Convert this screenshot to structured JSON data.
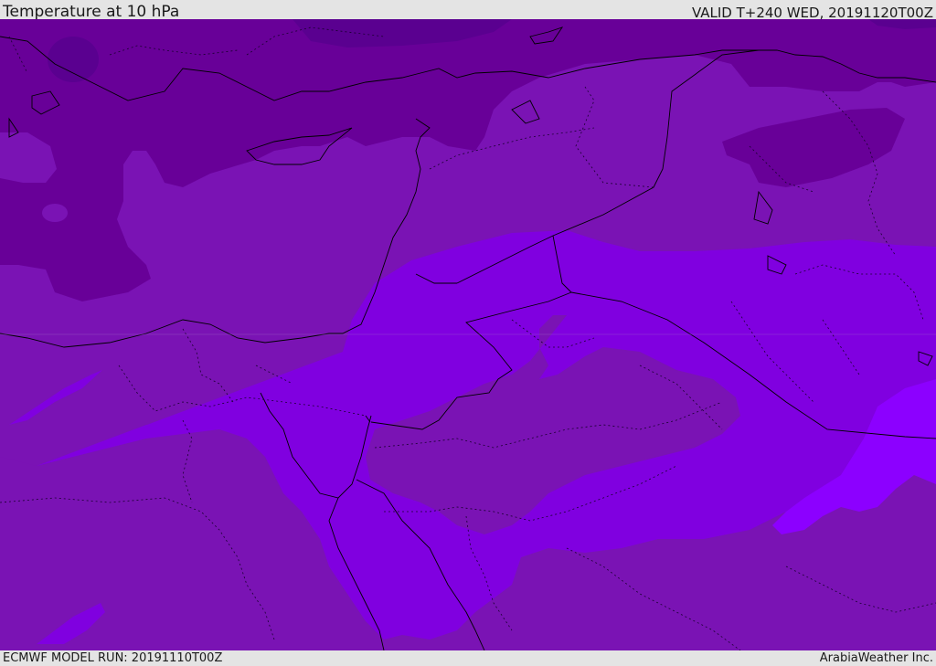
{
  "header": {
    "title": "Temperature at 10 hPa",
    "valid_time": "VALID T+240 WED, 20191120T00Z"
  },
  "footer": {
    "model_run": "ECMWF MODEL RUN: 20191110T00Z",
    "credit": "ArabiaWeather Inc."
  },
  "map": {
    "field": "temperature",
    "level": "10 hPa",
    "colors": {
      "darkest": "#5a0090",
      "dark": "#680098",
      "medium": "#7a13b4",
      "light": "#8000e0",
      "lightest": "#8c00ff",
      "coastline": "#000000",
      "border": "#000000"
    }
  }
}
